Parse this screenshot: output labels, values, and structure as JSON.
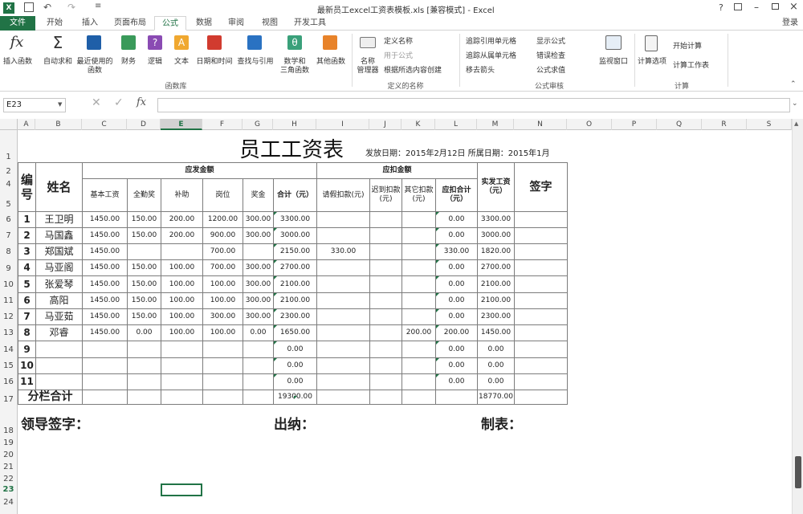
{
  "window": {
    "title": "最新员工excel工资表模板.xls  [兼容模式] - Excel",
    "help": "?",
    "login": "登录"
  },
  "tabs": [
    "文件",
    "开始",
    "插入",
    "页面布局",
    "公式",
    "数据",
    "审阅",
    "视图",
    "开发工具"
  ],
  "ribbon": {
    "insert_fn": "插入函数",
    "autosum": "自动求和",
    "recent": "最近使用的",
    "recent2": "函数",
    "finance": "财务",
    "logic": "逻辑",
    "text": "文本",
    "datetime": "日期和时间",
    "lookup": "查找与引用",
    "math": "数学和",
    "math2": "三角函数",
    "more": "其他函数",
    "group_lib": "函数库",
    "name_mgr": "名称",
    "name_mgr2": "管理器",
    "define_name": "定义名称",
    "use_formula": "用于公式",
    "create_sel": "根据所选内容创建",
    "group_names": "定义的名称",
    "trace_prec": "追踪引用单元格",
    "trace_dep": "追踪从属单元格",
    "remove_arrows": "移去箭头",
    "show_formulas": "显示公式",
    "error_check": "错误检查",
    "eval_formula": "公式求值",
    "watch": "监视窗口",
    "group_audit": "公式审核",
    "calc_opts": "计算选项",
    "calc_now": "开始计算",
    "calc_sheet": "计算工作表",
    "group_calc": "计算"
  },
  "formula": {
    "namebox": "E23",
    "fx": "fx",
    "value": ""
  },
  "columns": [
    "A",
    "B",
    "C",
    "D",
    "E",
    "F",
    "G",
    "H",
    "I",
    "J",
    "K",
    "L",
    "M",
    "N",
    "O",
    "P",
    "Q",
    "R",
    "S"
  ],
  "rows": [
    "1",
    "2",
    "4",
    "5",
    "6",
    "7",
    "8",
    "9",
    "10",
    "11",
    "12",
    "13",
    "14",
    "15",
    "16",
    "17",
    "18",
    "19",
    "20",
    "21",
    "22",
    "23",
    "24"
  ],
  "sheet": {
    "title": "员工工资表",
    "issue": "发放日期：2015年2月12日  所属日期：2015年1月",
    "h_id": "编号",
    "h_name": "姓名",
    "h_pay": "应发金额",
    "h_ded": "应扣金额",
    "h_actual": "实发工资（元）",
    "h_sign": "签字",
    "sub": [
      "基本工资",
      "全勤奖",
      "补助",
      "岗位",
      "奖金",
      "合计（元）",
      "请假扣款(元)",
      "迟到扣款(元)",
      "其它扣款(元)",
      "应扣合计（元）"
    ],
    "data": [
      [
        "1",
        "王卫明",
        "1450.00",
        "150.00",
        "200.00",
        "1200.00",
        "300.00",
        "3300.00",
        "",
        "",
        "",
        "0.00",
        "3300.00"
      ],
      [
        "2",
        "马国鑫",
        "1450.00",
        "150.00",
        "200.00",
        "900.00",
        "300.00",
        "3000.00",
        "",
        "",
        "",
        "0.00",
        "3000.00"
      ],
      [
        "3",
        "郑国斌",
        "1450.00",
        "",
        "",
        "700.00",
        "",
        "2150.00",
        "330.00",
        "",
        "",
        "330.00",
        "1820.00"
      ],
      [
        "4",
        "马亚阁",
        "1450.00",
        "150.00",
        "100.00",
        "700.00",
        "300.00",
        "2700.00",
        "",
        "",
        "",
        "0.00",
        "2700.00"
      ],
      [
        "5",
        "张爱琴",
        "1450.00",
        "150.00",
        "100.00",
        "100.00",
        "300.00",
        "2100.00",
        "",
        "",
        "",
        "0.00",
        "2100.00"
      ],
      [
        "6",
        "高阳",
        "1450.00",
        "150.00",
        "100.00",
        "100.00",
        "300.00",
        "2100.00",
        "",
        "",
        "",
        "0.00",
        "2100.00"
      ],
      [
        "7",
        "马亚茹",
        "1450.00",
        "150.00",
        "100.00",
        "300.00",
        "300.00",
        "2300.00",
        "",
        "",
        "",
        "0.00",
        "2300.00"
      ],
      [
        "8",
        "邓睿",
        "1450.00",
        "0.00",
        "100.00",
        "100.00",
        "0.00",
        "1650.00",
        "",
        "",
        "200.00",
        "200.00",
        "1450.00"
      ],
      [
        "9",
        "",
        "",
        "",
        "",
        "",
        "",
        "0.00",
        "",
        "",
        "",
        "0.00",
        "0.00"
      ],
      [
        "10",
        "",
        "",
        "",
        "",
        "",
        "",
        "0.00",
        "",
        "",
        "",
        "0.00",
        "0.00"
      ],
      [
        "11",
        "",
        "",
        "",
        "",
        "",
        "",
        "0.00",
        "",
        "",
        "",
        "0.00",
        "0.00"
      ]
    ],
    "subtotal_label": "分栏合计",
    "subtotal_total": "19300.00",
    "subtotal_actual": "18770.00",
    "leader": "领导签字：",
    "cashier": "出纳：",
    "maker": "制表："
  }
}
